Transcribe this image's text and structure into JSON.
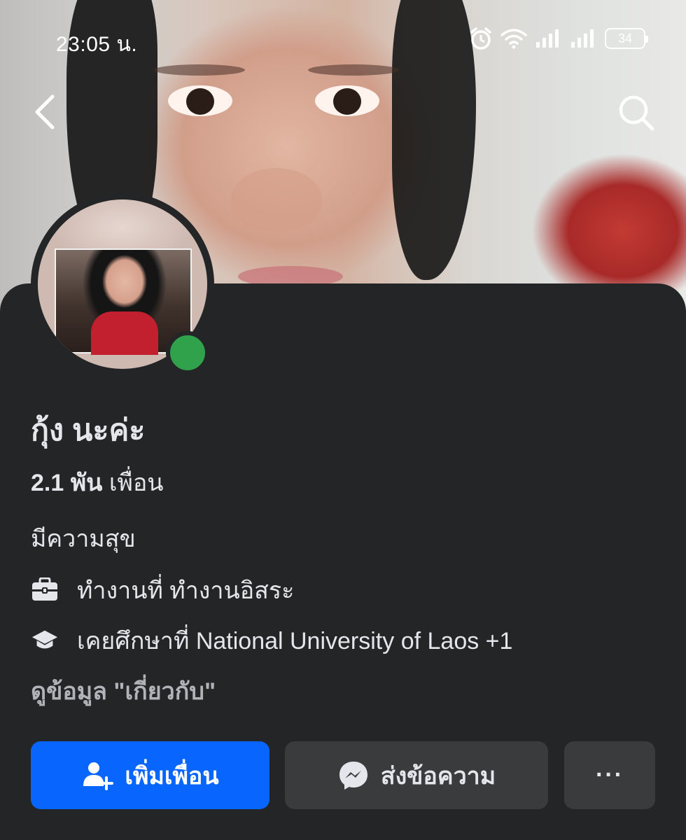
{
  "status_bar": {
    "time": "23:05 น.",
    "battery": "34",
    "icons": [
      "alarm-icon",
      "wifi-icon",
      "signal-icon",
      "signal-icon",
      "battery-icon"
    ]
  },
  "nav": {
    "back_icon": "chevron-left-icon",
    "search_icon": "search-icon"
  },
  "profile": {
    "name": "กุ้ง นะค่ะ",
    "friends_count": "2.1 พัน",
    "friends_label": "เพื่อน",
    "bio": "มีความสุข",
    "work": "ทำงานที่ ทำงานอิสระ",
    "education": "เคยศึกษาที่ National University of Laos +1",
    "about_link": "ดูข้อมูล \"เกี่ยวกับ\"",
    "online": true
  },
  "actions": {
    "add_friend": "เพิ่มเพื่อน",
    "message": "ส่งข้อความ",
    "more": "···"
  },
  "colors": {
    "background": "#242526",
    "primary_button": "#0866ff",
    "secondary_button": "#3a3b3c",
    "online": "#31a24c",
    "muted_text": "#b0b3b8"
  }
}
